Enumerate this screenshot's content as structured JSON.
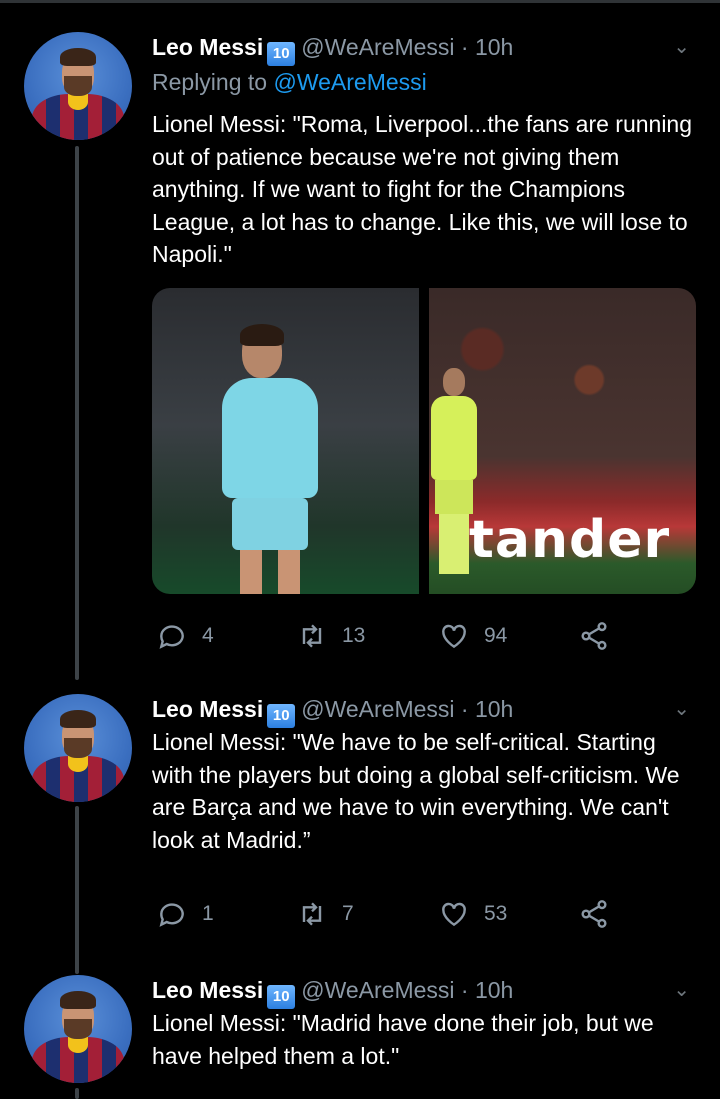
{
  "tweets": [
    {
      "name": "Leo Messi",
      "badge": "10",
      "handle": "@WeAreMessi",
      "dot": "·",
      "time": "10h",
      "reply_prefix": "Replying to ",
      "reply_handle": "@WeAreMessi",
      "text": "Lionel Messi: \"Roma, Liverpool...the fans are running out of patience because we're not giving them anything. If we want to fight for the Champions League, a lot has to change. Like this, we will lose to Napoli.\"",
      "media_banner_text": "tander",
      "replies": "4",
      "retweets": "13",
      "likes": "94"
    },
    {
      "name": "Leo Messi",
      "badge": "10",
      "handle": "@WeAreMessi",
      "dot": "·",
      "time": "10h",
      "text": "Lionel Messi: \"We have to be self-critical. Starting with the players but doing a global self-criticism. We are Barça and we have to win everything. We can't look at Madrid.”",
      "replies": "1",
      "retweets": "7",
      "likes": "53"
    },
    {
      "name": "Leo Messi",
      "badge": "10",
      "handle": "@WeAreMessi",
      "dot": "·",
      "time": "10h",
      "text": "Lionel Messi: \"Madrid have done their job, but we have helped them a lot.\""
    }
  ]
}
